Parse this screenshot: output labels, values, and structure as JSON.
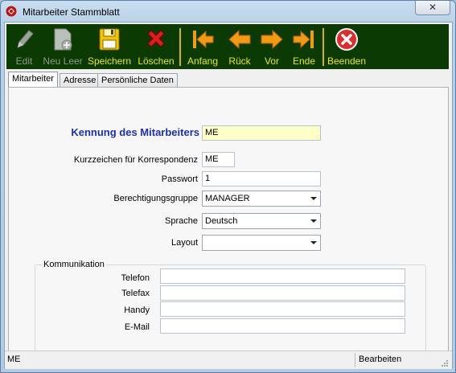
{
  "window": {
    "title": "Mitarbeiter Stammblatt",
    "close_glyph": "✕",
    "icons": {
      "app": "app-logo-icon"
    }
  },
  "toolbar": {
    "bg_color": "#0b3a02",
    "label_color": "#e8e800",
    "buttons": [
      {
        "label": "Edit",
        "icon": "pencil-icon",
        "enabled": false
      },
      {
        "label": "Neu Leer",
        "icon": "new-document-icon",
        "enabled": false
      },
      {
        "label": "Speichern",
        "icon": "floppy-disk-icon",
        "enabled": true
      },
      {
        "label": "Löschen",
        "icon": "red-x-icon",
        "enabled": true
      },
      {
        "label": "Anfang",
        "icon": "first-record-icon",
        "enabled": true
      },
      {
        "label": "Rück",
        "icon": "previous-arrow-icon",
        "enabled": true
      },
      {
        "label": "Vor",
        "icon": "next-arrow-icon",
        "enabled": true
      },
      {
        "label": "Ende",
        "icon": "last-record-icon",
        "enabled": true
      },
      {
        "label": "Beenden",
        "icon": "exit-icon",
        "enabled": true
      }
    ]
  },
  "tabs": [
    {
      "label": "Mitarbeiter",
      "active": true
    },
    {
      "label": "Adresse",
      "active": false
    },
    {
      "label": "Persönliche Daten",
      "active": false
    }
  ],
  "form": {
    "kennung": {
      "label": "Kennung des Mitarbeiters",
      "value": "ME"
    },
    "kurzzeichen": {
      "label": "Kurzzeichen für Korrespondenz",
      "value": "ME"
    },
    "passwort": {
      "label": "Passwort",
      "value": "1"
    },
    "berechtigung": {
      "label": "Berechtigungsgruppe",
      "value": "MANAGER"
    },
    "sprache": {
      "label": "Sprache",
      "value": "Deutsch"
    },
    "layout": {
      "label": "Layout",
      "value": ""
    }
  },
  "kommunikation": {
    "title": "Kommunikation",
    "telefon": {
      "label": "Telefon",
      "value": ""
    },
    "telefax": {
      "label": "Telefax",
      "value": ""
    },
    "handy": {
      "label": "Handy",
      "value": ""
    },
    "email": {
      "label": "E-Mail",
      "value": ""
    }
  },
  "status": {
    "left": "ME",
    "right": "Bearbeiten"
  }
}
